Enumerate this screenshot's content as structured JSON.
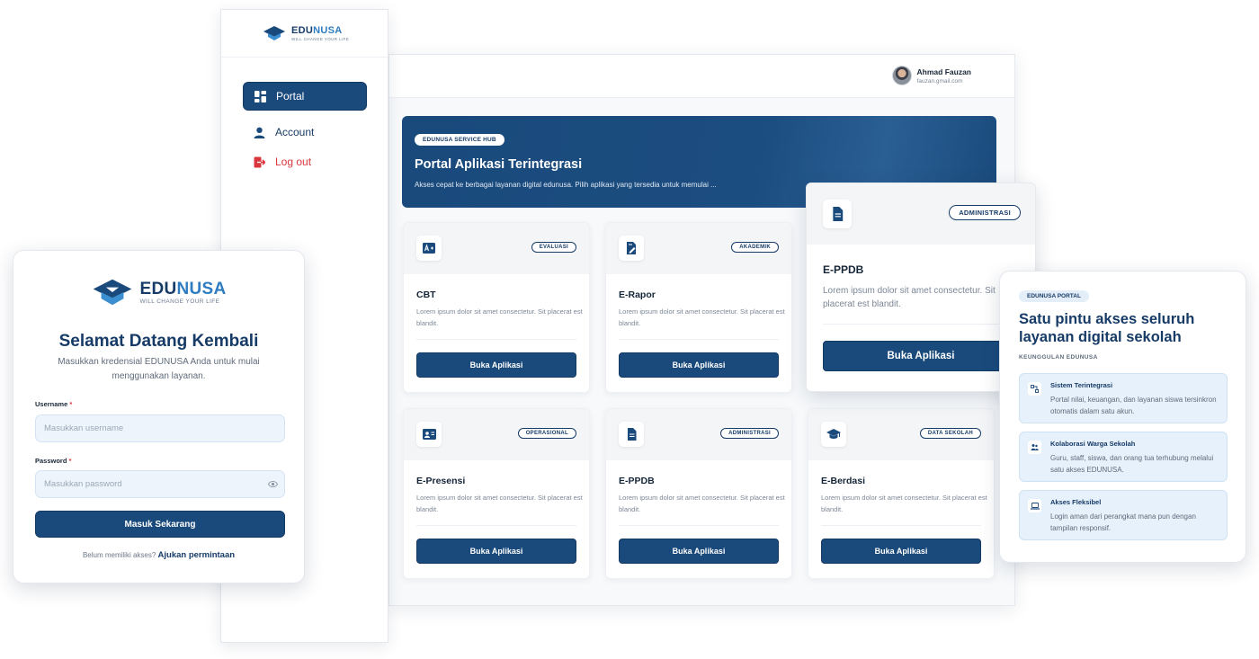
{
  "brand": {
    "name_part1": "EDU",
    "name_part2": "NUSA",
    "tagline": "WILL CHANGE YOUR LIFE"
  },
  "sidebar": {
    "items": [
      {
        "label": "Portal",
        "icon": "grid-icon",
        "active": true
      },
      {
        "label": "Account",
        "icon": "user-icon",
        "active": false
      },
      {
        "label": "Log out",
        "icon": "logout-icon",
        "active": false
      }
    ]
  },
  "topbar": {
    "user_name": "Ahmad Fauzan",
    "user_email": "fauzan.gmail.com"
  },
  "hero": {
    "badge": "EDUNUSA SERVICE HUB",
    "title": "Portal Aplikasi Terintegrasi",
    "subtitle": "Akses cepat ke berbagai layanan digital edunusa. Pilih aplikasi yang tersedia untuk memulai ..."
  },
  "apps": [
    {
      "name": "CBT",
      "tag": "EVALUASI",
      "icon": "exam-grade-icon",
      "desc": "Lorem ipsum dolor sit amet consectetur. Sit placerat est blandit.",
      "button": "Buka Aplikasi"
    },
    {
      "name": "E-Rapor",
      "tag": "AKADEMIK",
      "icon": "report-edit-icon",
      "desc": "Lorem ipsum dolor sit amet consectetur. Sit placerat est blandit.",
      "button": "Buka Aplikasi"
    },
    {
      "name": "E-Presensi",
      "tag": "OPERASIONAL",
      "icon": "id-card-icon",
      "desc": "Lorem ipsum dolor sit amet consectetur. Sit placerat est blandit.",
      "button": "Buka Aplikasi"
    },
    {
      "name": "E-PPDB",
      "tag": "ADMINISTRASI",
      "icon": "document-icon",
      "desc": "Lorem ipsum dolor sit amet consectetur. Sit placerat est blandit.",
      "button": "Buka Aplikasi"
    },
    {
      "name": "E-Berdasi",
      "tag": "DATA SEKOLAH",
      "icon": "graduation-cap-icon",
      "desc": "Lorem ipsum dolor sit amet consectetur. Sit placerat est blandit.",
      "button": "Buka Aplikasi"
    }
  ],
  "popup_card": {
    "name": "E-PPDB",
    "tag": "ADMINISTRASI",
    "icon": "document-icon",
    "desc": "Lorem ipsum dolor sit amet consectetur. Sit placerat est blandit.",
    "button": "Buka Aplikasi"
  },
  "login": {
    "title": "Selamat Datang Kembali",
    "subtitle": "Masukkan kredensial EDUNUSA Anda untuk mulai menggunakan layanan.",
    "username_label": "Username",
    "username_placeholder": "Masukkan username",
    "password_label": "Password",
    "password_placeholder": "Masukkan password",
    "required_mark": "*",
    "submit": "Masuk Sekarang",
    "footer_text": "Belum memiliki akses?",
    "footer_link": "Ajukan permintaan"
  },
  "info": {
    "badge": "EDUNUSA PORTAL",
    "title": "Satu pintu akses seluruh layanan digital sekolah",
    "kicker": "KEUNGGULAN EDUNUSA",
    "features": [
      {
        "title": "Sistem Terintegrasi",
        "desc": "Portal nilai, keuangan, dan layanan siswa tersinkron otomatis dalam satu akun.",
        "icon": "integration-icon"
      },
      {
        "title": "Kolaborasi Warga Sekolah",
        "desc": "Guru, staff, siswa, dan orang tua terhubung melalui satu akses EDUNUSA.",
        "icon": "people-icon"
      },
      {
        "title": "Akses Fleksibel",
        "desc": "Login aman dari perangkat mana pun dengan tampilan responsif.",
        "icon": "laptop-icon"
      }
    ]
  },
  "colors": {
    "primary": "#1a4a7c",
    "accent": "#2f7cc0",
    "danger": "#d9363e"
  }
}
